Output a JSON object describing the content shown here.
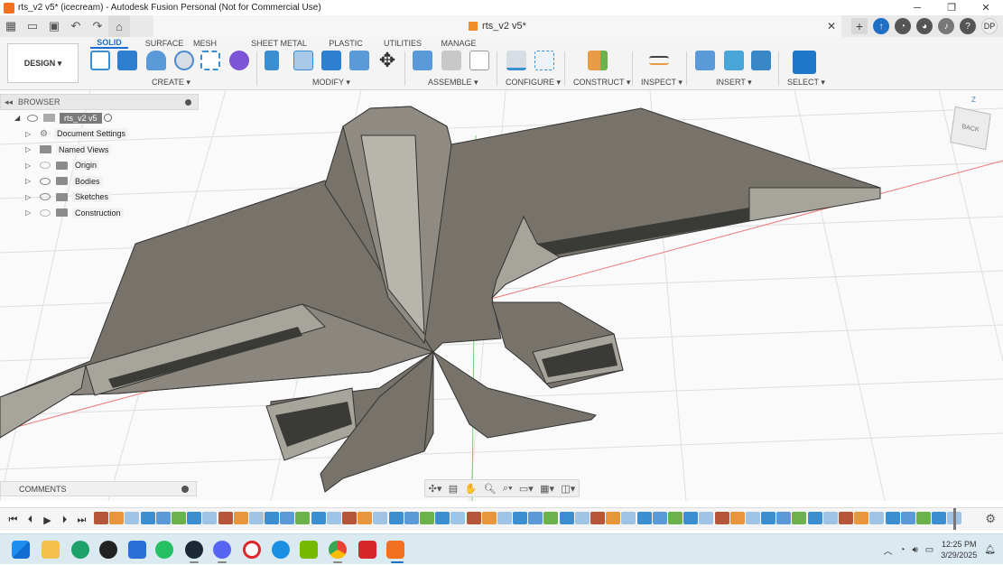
{
  "window": {
    "title": "rts_v2 v5* (icecream) - Autodesk Fusion Personal (Not for Commercial Use)",
    "controls": [
      "minimize-icon",
      "restore-icon",
      "close-icon"
    ]
  },
  "document_tab": {
    "name": "rts_v2 v5*",
    "close_glyph": "✕",
    "user_initials": "DP"
  },
  "ribbon": {
    "workspace": "DESIGN ▾",
    "tabs": [
      "SOLID",
      "SURFACE",
      "MESH",
      "SHEET METAL",
      "PLASTIC",
      "UTILITIES",
      "MANAGE"
    ],
    "active_tab": "SOLID",
    "groups": [
      "CREATE ▾",
      "MODIFY ▾",
      "ASSEMBLE ▾",
      "CONFIGURE ▾",
      "CONSTRUCT ▾",
      "INSPECT ▾",
      "INSERT ▾",
      "SELECT ▾"
    ]
  },
  "browser": {
    "title": "BROWSER",
    "root": "rts_v2 v5",
    "items": [
      "Document Settings",
      "Named Views",
      "Origin",
      "Bodies",
      "Sketches",
      "Construction"
    ]
  },
  "comments": {
    "label": "COMMENTS"
  },
  "viewcube": {
    "face": "BACK",
    "axis": "Z"
  },
  "taskbar": {
    "time": "12:25 PM",
    "date": "3/29/2025"
  },
  "colors": {
    "accent": "#1a6dd4",
    "model_top": "#78746b",
    "model_side": "#a7a49b",
    "grid": "#dcdcdc",
    "axis_red": "#e05050"
  }
}
